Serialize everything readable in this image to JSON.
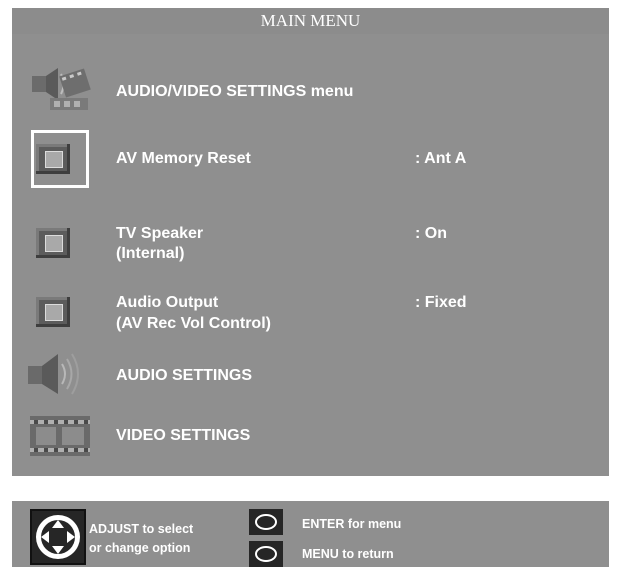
{
  "header": {
    "title": "MAIN MENU"
  },
  "menu": {
    "items": [
      {
        "label": "AUDIO/VIDEO SETTINGS menu",
        "icon": "av-settings-icon"
      },
      {
        "label": "AV Memory Reset",
        "value": ": Ant A",
        "icon": "square-button-icon"
      },
      {
        "label": "TV Speaker",
        "sublabel": "(Internal)",
        "value": ": On",
        "icon": "square-button-icon"
      },
      {
        "label": "Audio Output",
        "sublabel": "(AV Rec Vol Control)",
        "value": ": Fixed",
        "icon": "square-button-icon"
      },
      {
        "label": "AUDIO SETTINGS",
        "icon": "speaker-icon"
      },
      {
        "label": "VIDEO SETTINGS",
        "icon": "film-strip-icon"
      }
    ]
  },
  "footer": {
    "adjust_line1": "ADJUST to select",
    "adjust_line2": "or change option",
    "enter_label": "ENTER for menu",
    "menu_label": "MENU  to  return"
  },
  "colors": {
    "panel": "#8f8f8f",
    "title_bar": "#8c8c8c",
    "text": "#ffffff",
    "icon_dark": "#262626"
  }
}
